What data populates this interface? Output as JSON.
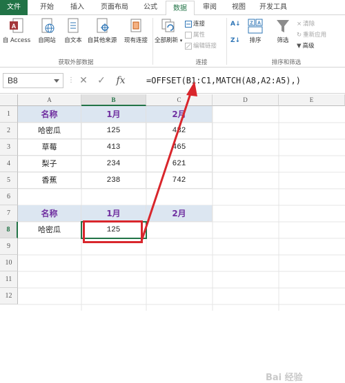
{
  "tabs": [
    "文件",
    "开始",
    "插入",
    "页面布局",
    "公式",
    "数据",
    "审阅",
    "视图",
    "开发工具"
  ],
  "active_tab": "数据",
  "ribbon": {
    "ext_data": {
      "access": "自 Access",
      "web": "自网站",
      "text": "自文本",
      "other": "自其他来源",
      "existing": "现有连接",
      "group": "获取外部数据"
    },
    "connections": {
      "refresh_all": "全部刷新",
      "connect": "连接",
      "properties": "属性",
      "edit_links": "编辑链接",
      "group": "连接"
    },
    "sort_filter": {
      "sort": "排序",
      "filter": "筛选",
      "clear": "清除",
      "reapply": "重新应用",
      "advanced": "高级",
      "group": "排序和筛选"
    }
  },
  "name_box": "B8",
  "formula": "=OFFSET(B1:C1,MATCH(A8,A2:A5),)",
  "columns": [
    "A",
    "B",
    "C",
    "D",
    "E"
  ],
  "rows": [
    "1",
    "2",
    "3",
    "4",
    "5",
    "6",
    "7",
    "8",
    "9",
    "10",
    "11",
    "12"
  ],
  "cells": {
    "A1": "名称",
    "B1": "1月",
    "C1": "2月",
    "A2": "哈密瓜",
    "B2": "125",
    "C2": "432",
    "A3": "草莓",
    "B3": "413",
    "C3": "465",
    "A4": "梨子",
    "B4": "234",
    "C4": "621",
    "A5": "香蕉",
    "B5": "238",
    "C5": "742",
    "A7": "名称",
    "B7": "1月",
    "C7": "2月",
    "A8": "哈密瓜",
    "B8": "125"
  },
  "watermark": "Bai 经验",
  "colors": {
    "accent": "#217346",
    "header_fill": "#dce6f1",
    "header_text": "#7030a0",
    "annotation": "#d9262c"
  }
}
